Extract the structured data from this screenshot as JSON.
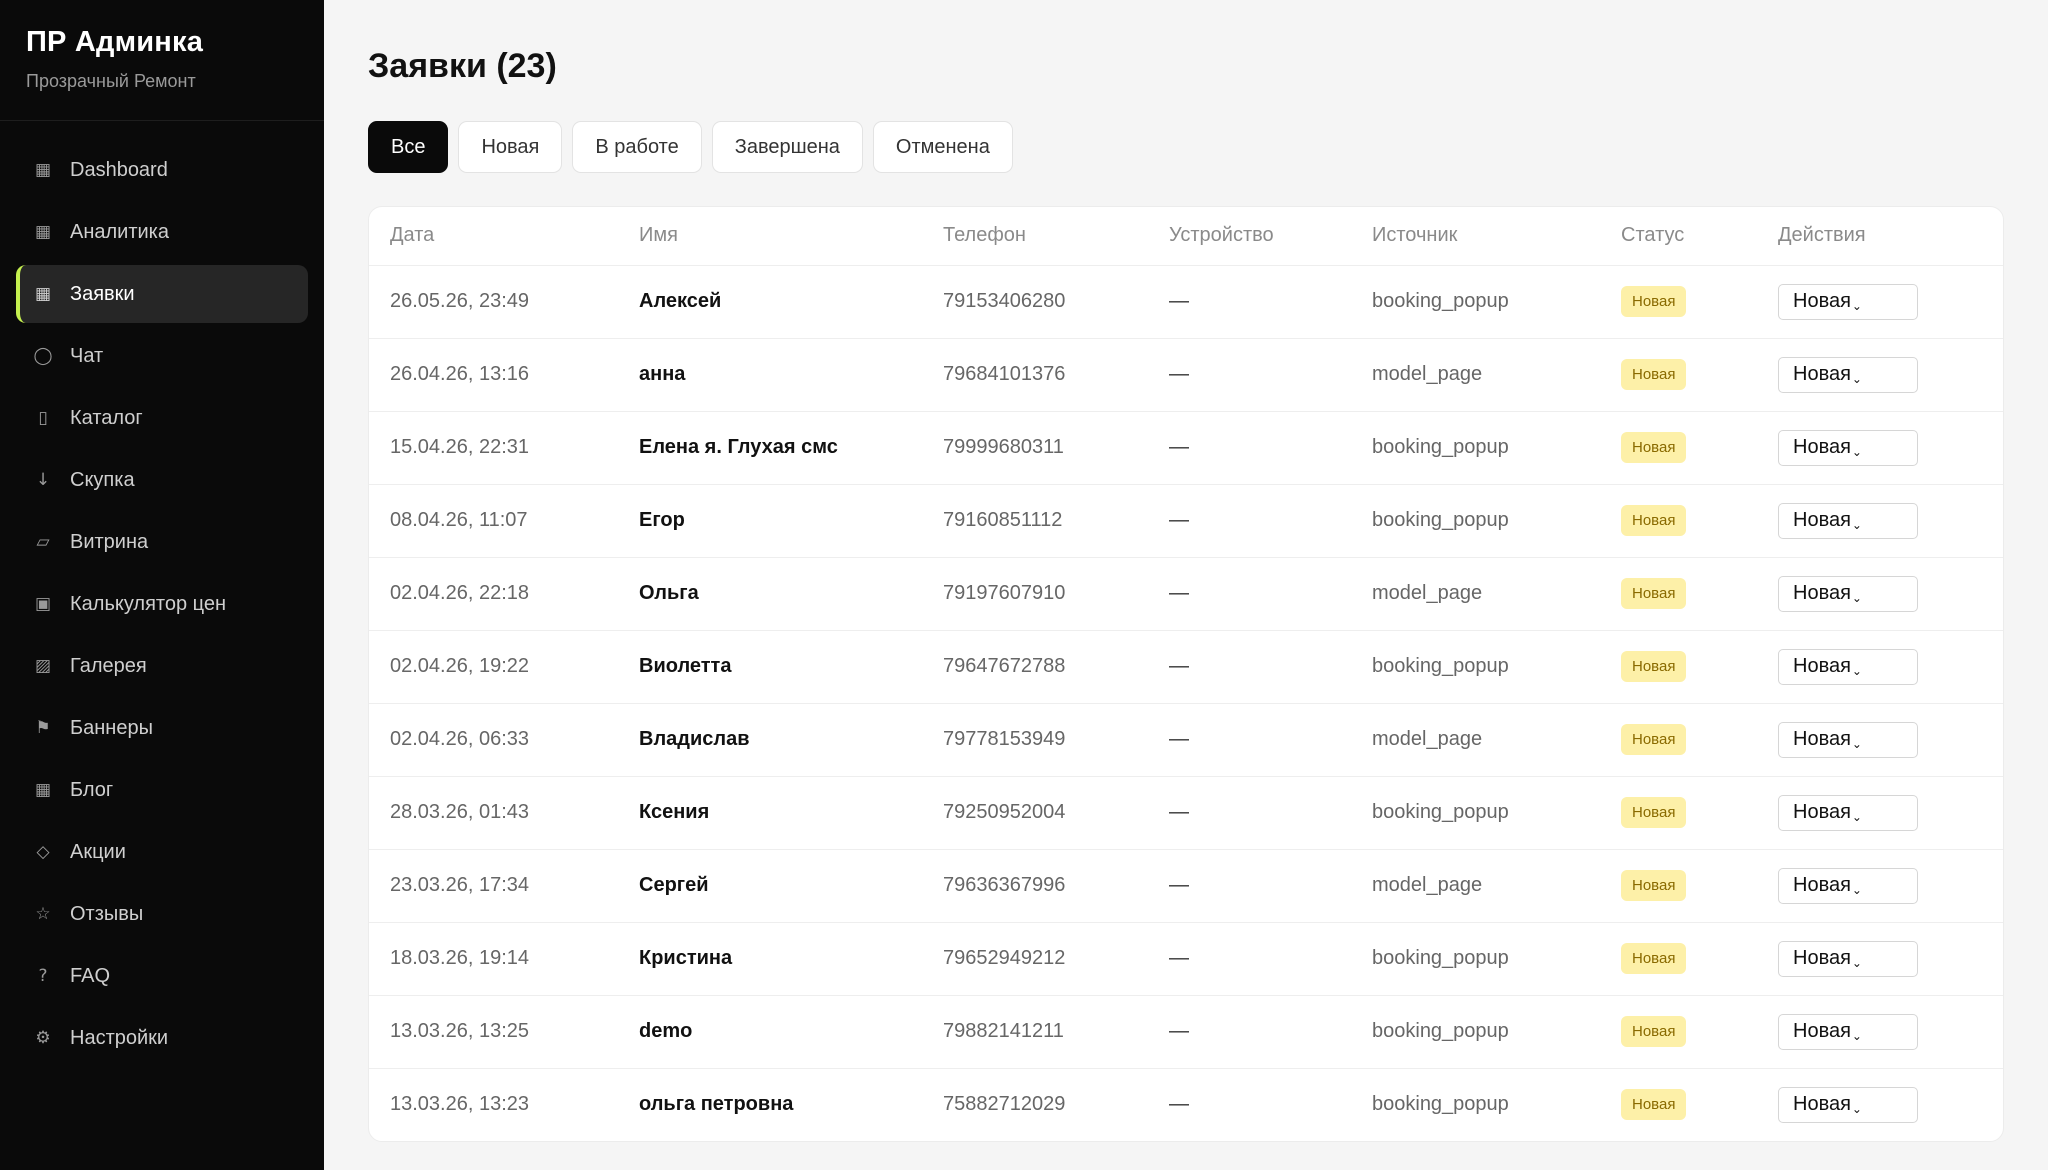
{
  "brand": {
    "title": "ПР Админка",
    "subtitle": "Прозрачный Ремонт"
  },
  "sidebar": {
    "items": [
      {
        "label": "Dashboard",
        "icon": "▦",
        "icon_name": "dashboard-icon",
        "active": false
      },
      {
        "label": "Аналитика",
        "icon": "▦",
        "icon_name": "analytics-icon",
        "active": false
      },
      {
        "label": "Заявки",
        "icon": "▦",
        "icon_name": "requests-icon",
        "active": true
      },
      {
        "label": "Чат",
        "icon": "◯",
        "icon_name": "chat-icon",
        "active": false
      },
      {
        "label": "Каталог",
        "icon": "▯",
        "icon_name": "catalog-icon",
        "active": false
      },
      {
        "label": "Скупка",
        "icon": "↓",
        "icon_name": "buyout-icon",
        "active": false
      },
      {
        "label": "Витрина",
        "icon": "▱",
        "icon_name": "showcase-icon",
        "active": false
      },
      {
        "label": "Калькулятор цен",
        "icon": "▣",
        "icon_name": "calculator-icon",
        "active": false
      },
      {
        "label": "Галерея",
        "icon": "▨",
        "icon_name": "gallery-icon",
        "active": false
      },
      {
        "label": "Баннеры",
        "icon": "⚑",
        "icon_name": "banners-icon",
        "active": false
      },
      {
        "label": "Блог",
        "icon": "▦",
        "icon_name": "blog-icon",
        "active": false
      },
      {
        "label": "Акции",
        "icon": "◇",
        "icon_name": "promotions-icon",
        "active": false
      },
      {
        "label": "Отзывы",
        "icon": "☆",
        "icon_name": "reviews-icon",
        "active": false
      },
      {
        "label": "FAQ",
        "icon": "?",
        "icon_name": "faq-icon",
        "active": false
      },
      {
        "label": "Настройки",
        "icon": "⚙",
        "icon_name": "settings-icon",
        "active": false
      }
    ]
  },
  "main": {
    "title": "Заявки (23)",
    "filters": [
      {
        "label": "Все",
        "active": true
      },
      {
        "label": "Новая",
        "active": false
      },
      {
        "label": "В работе",
        "active": false
      },
      {
        "label": "Завершена",
        "active": false
      },
      {
        "label": "Отменена",
        "active": false
      }
    ],
    "columns": [
      "Дата",
      "Имя",
      "Телефон",
      "Устройство",
      "Источник",
      "Статус",
      "Действия"
    ],
    "rows": [
      {
        "date": "26.05.26, 23:49",
        "name": "Алексей",
        "phone": "79153406280",
        "device": "—",
        "source": "booking_popup",
        "status": "Новая",
        "action": "Новая"
      },
      {
        "date": "26.04.26, 13:16",
        "name": "анна",
        "phone": "79684101376",
        "device": "—",
        "source": "model_page",
        "status": "Новая",
        "action": "Новая"
      },
      {
        "date": "15.04.26, 22:31",
        "name": "Елена я. Глухая смс",
        "phone": "79999680311",
        "device": "—",
        "source": "booking_popup",
        "status": "Новая",
        "action": "Новая"
      },
      {
        "date": "08.04.26, 11:07",
        "name": "Егор",
        "phone": "79160851112",
        "device": "—",
        "source": "booking_popup",
        "status": "Новая",
        "action": "Новая"
      },
      {
        "date": "02.04.26, 22:18",
        "name": "Ольга",
        "phone": "79197607910",
        "device": "—",
        "source": "model_page",
        "status": "Новая",
        "action": "Новая"
      },
      {
        "date": "02.04.26, 19:22",
        "name": "Виолетта",
        "phone": "79647672788",
        "device": "—",
        "source": "booking_popup",
        "status": "Новая",
        "action": "Новая"
      },
      {
        "date": "02.04.26, 06:33",
        "name": "Владислав",
        "phone": "79778153949",
        "device": "—",
        "source": "model_page",
        "status": "Новая",
        "action": "Новая"
      },
      {
        "date": "28.03.26, 01:43",
        "name": "Ксения",
        "phone": "79250952004",
        "device": "—",
        "source": "booking_popup",
        "status": "Новая",
        "action": "Новая"
      },
      {
        "date": "23.03.26, 17:34",
        "name": "Сергей",
        "phone": "79636367996",
        "device": "—",
        "source": "model_page",
        "status": "Новая",
        "action": "Новая"
      },
      {
        "date": "18.03.26, 19:14",
        "name": "Кристина",
        "phone": "79652949212",
        "device": "—",
        "source": "booking_popup",
        "status": "Новая",
        "action": "Новая"
      },
      {
        "date": "13.03.26, 13:25",
        "name": "demo",
        "phone": "79882141211",
        "device": "—",
        "source": "booking_popup",
        "status": "Новая",
        "action": "Новая"
      },
      {
        "date": "13.03.26, 13:23",
        "name": "ольга петровна",
        "phone": "75882712029",
        "device": "—",
        "source": "booking_popup",
        "status": "Новая",
        "action": "Новая"
      }
    ]
  },
  "colors": {
    "accent": "#c5f04f",
    "badge_bg": "#fdf0a8",
    "badge_text": "#8a6a00",
    "sidebar_bg": "#0a0a0a"
  }
}
